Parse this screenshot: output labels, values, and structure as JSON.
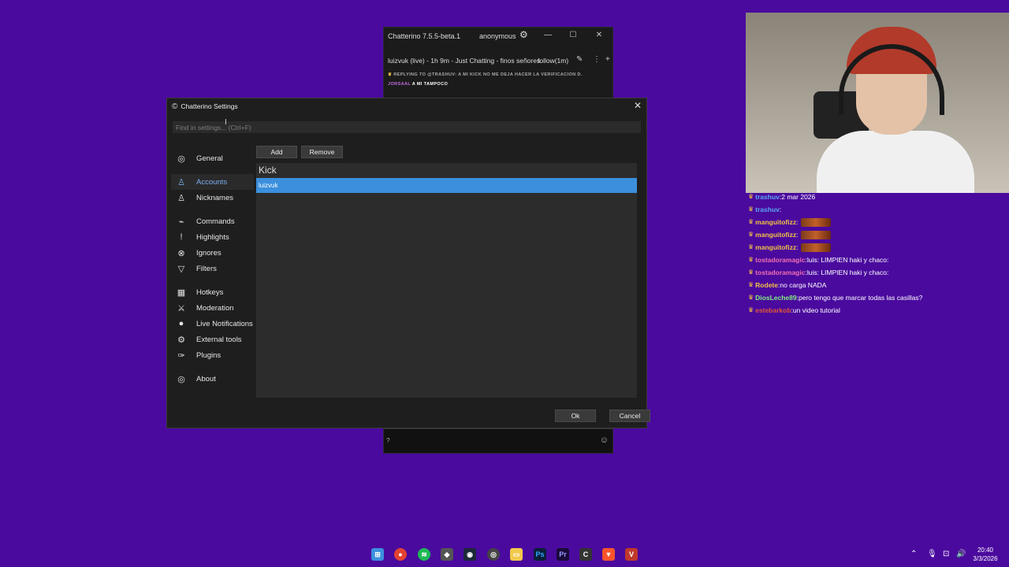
{
  "chat_window": {
    "title": "Chatterino 7.5.5-beta.1",
    "user": "anonymous",
    "tab_title": "luizvuk (live) - 1h 9m - Just Chatting - finos señores",
    "follow_label": "follow(1m)",
    "reply_line": "REPLYING TO @TRASHUV: A MI KICK NO ME DEJA HACER LA VERIFICACION D.",
    "reply_user": "JORSAAL",
    "reply_text": "A MI TAMPOCO",
    "input_value": "?"
  },
  "settings": {
    "title": "Chatterino Settings",
    "search_placeholder": "Find in settings... (Ctrl+F)",
    "sidebar": [
      {
        "label": "General",
        "icon": "general-icon"
      },
      {
        "label": "Accounts",
        "icon": "user-icon",
        "active": true
      },
      {
        "label": "Nicknames",
        "icon": "user-icon"
      },
      {
        "label": "Commands",
        "icon": "commands-icon"
      },
      {
        "label": "Highlights",
        "icon": "exclamation-icon"
      },
      {
        "label": "Ignores",
        "icon": "ignore-icon"
      },
      {
        "label": "Filters",
        "icon": "filter-icon"
      },
      {
        "label": "Hotkeys",
        "icon": "keyboard-icon"
      },
      {
        "label": "Moderation",
        "icon": "sword-icon"
      },
      {
        "label": "Live Notifications",
        "icon": "live-icon"
      },
      {
        "label": "External tools",
        "icon": "gear-icon"
      },
      {
        "label": "Plugins",
        "icon": "plugin-icon"
      },
      {
        "label": "About",
        "icon": "general-icon"
      }
    ],
    "add_label": "Add",
    "remove_label": "Remove",
    "account_group": "Kick",
    "accounts": [
      "luizvuk"
    ],
    "ok_label": "Ok",
    "cancel_label": "Cancel"
  },
  "overlay_chat": [
    {
      "user": "trashuv",
      "color": "#58a8f0",
      "text": "2 mar 2026"
    },
    {
      "user": "trashuv",
      "color": "#58a8f0",
      "text": ""
    },
    {
      "user": "manguitofizz",
      "color": "#f3c343",
      "text": ""
    },
    {
      "user": "manguitofizz",
      "color": "#f3c343",
      "text": ""
    },
    {
      "user": "manguitofizz",
      "color": "#f3c343",
      "text": ""
    },
    {
      "user": "tostadoramagic",
      "color": "#f06fb0",
      "text": "luis: LIMPIEN haki y chaco:"
    },
    {
      "user": "tostadoramagic",
      "color": "#f06fb0",
      "text": "luis: LIMPIEN haki y chaco:"
    },
    {
      "user": "Rodete",
      "color": "#f3c343",
      "text": "no carga NADA"
    },
    {
      "user": "DiosLeche89",
      "color": "#7ef07e",
      "text": "pero tengo que marcar todas las casillas?"
    },
    {
      "user": "estebarkob",
      "color": "#e2553a",
      "text": "un video tutorial"
    }
  ],
  "taskbar": {
    "time": "20:40",
    "date": "3/3/2026"
  },
  "colors": {
    "desktop": "#4a0a9e",
    "selection": "#3b8fdd",
    "accent_link": "#7fb2f0"
  }
}
